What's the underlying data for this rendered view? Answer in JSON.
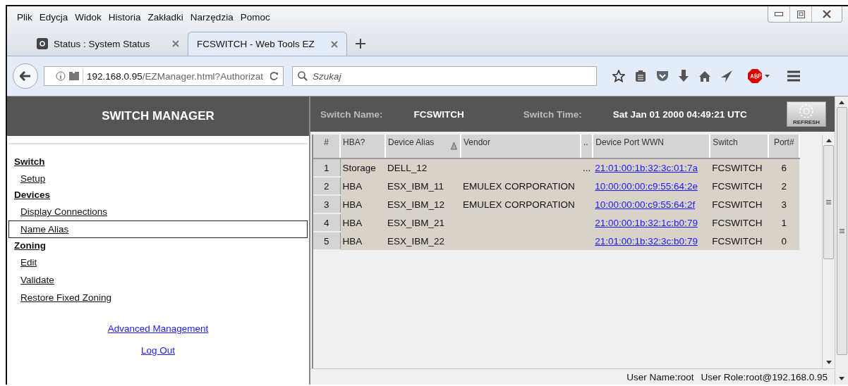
{
  "menu_bar": [
    "Plik",
    "Edycja",
    "Widok",
    "Historia",
    "Zakładki",
    "Narzędzia",
    "Pomoc"
  ],
  "tabs": [
    {
      "label": "Status : System Status",
      "selected": false
    },
    {
      "label": "FCSWITCH - Web Tools EZ",
      "selected": true
    }
  ],
  "address_bar": {
    "host": "192.168.0.95",
    "path": "/EZManager.html?Authorizat"
  },
  "search": {
    "placeholder": "Szukaj"
  },
  "sidebar": {
    "title": "SWITCH MANAGER",
    "sections": [
      {
        "label": "Switch",
        "items": [
          {
            "label": "Setup",
            "selected": false
          }
        ]
      },
      {
        "label": "Devices",
        "items": [
          {
            "label": "Display Connections",
            "selected": false
          },
          {
            "label": "Name Alias",
            "selected": true
          }
        ]
      },
      {
        "label": "Zoning",
        "items": [
          {
            "label": "Edit",
            "selected": false
          },
          {
            "label": "Validate",
            "selected": false
          },
          {
            "label": "Restore Fixed Zoning",
            "selected": false
          }
        ]
      }
    ],
    "links": [
      "Advanced Management",
      "Log Out"
    ]
  },
  "info_bar": {
    "name_label": "Switch Name:",
    "name": "FCSWITCH",
    "time_label": "Switch Time:",
    "time": "Sat Jan 01 2000 04:49:21 UTC",
    "refresh": "REFRESH"
  },
  "table": {
    "columns": [
      {
        "label": "#",
        "kind": "number",
        "sorted": false
      },
      {
        "label": "HBA?",
        "kind": "text",
        "sorted": false
      },
      {
        "label": "Device Alias",
        "kind": "text",
        "sorted": true
      },
      {
        "label": "Vendor",
        "kind": "text",
        "sorted": false
      },
      {
        "label": "..",
        "kind": "text",
        "sorted": false
      },
      {
        "label": "Device Port WWN",
        "kind": "link",
        "sorted": false
      },
      {
        "label": "Switch",
        "kind": "text",
        "sorted": false
      },
      {
        "label": "Port#",
        "kind": "center",
        "sorted": false
      }
    ],
    "rows": [
      {
        "cells": [
          "1",
          "Storage",
          "DELL_12",
          "",
          "...",
          "21:01:00:1b:32:3c:01:7a",
          "FCSWITCH",
          "6"
        ]
      },
      {
        "cells": [
          "2",
          "HBA",
          "ESX_IBM_11",
          "EMULEX CORPORATION",
          "",
          "10:00:00:00:c9:55:64:2e",
          "FCSWITCH",
          "2"
        ]
      },
      {
        "cells": [
          "3",
          "HBA",
          "ESX_IBM_12",
          "EMULEX CORPORATION",
          "",
          "10:00:00:00:c9:55:64:2f",
          "FCSWITCH",
          "3"
        ]
      },
      {
        "cells": [
          "4",
          "HBA",
          "ESX_IBM_21",
          "",
          "",
          "21:00:00:1b:32:1c:b0:79",
          "FCSWITCH",
          "1"
        ]
      },
      {
        "cells": [
          "5",
          "HBA",
          "ESX_IBM_22",
          "",
          "",
          "21:01:00:1b:32:3c:b0:79",
          "FCSWITCH",
          "0"
        ]
      }
    ]
  },
  "status_bar": {
    "user_name": "User Name:root",
    "user_role": "User Role:root@192.168.0.95"
  }
}
